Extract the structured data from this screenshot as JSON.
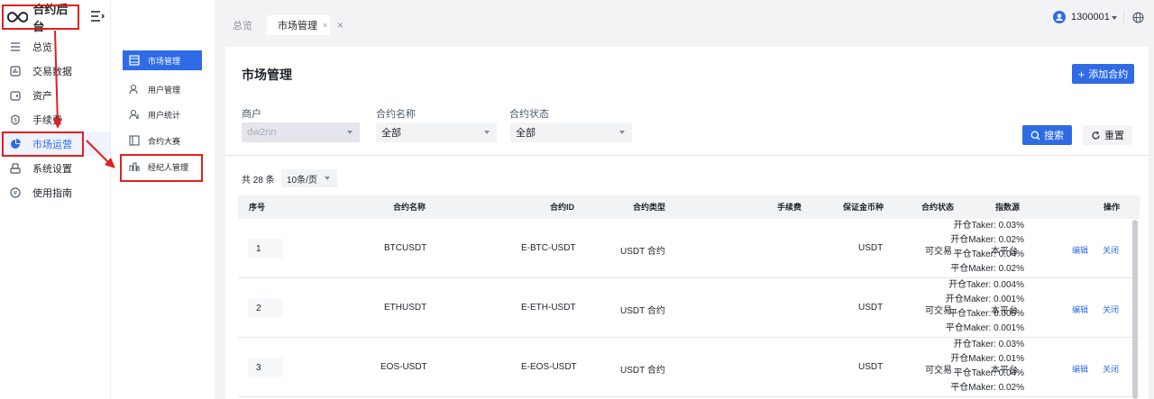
{
  "brand": {
    "name": "合约后台"
  },
  "nav": [
    {
      "label": "总览",
      "icon": "menu-icon"
    },
    {
      "label": "交易数据",
      "icon": "chart-icon"
    },
    {
      "label": "资产",
      "icon": "asset-icon"
    },
    {
      "label": "手续费",
      "icon": "fee-icon"
    },
    {
      "label": "市场运营",
      "icon": "pie-icon",
      "active": true
    },
    {
      "label": "系统设置",
      "icon": "settings-icon"
    },
    {
      "label": "使用指南",
      "icon": "guide-icon"
    }
  ],
  "subnav": [
    {
      "label": "市场管理",
      "icon": "market-icon",
      "active": true
    },
    {
      "label": "用户管理",
      "icon": "user-icon"
    },
    {
      "label": "用户统计",
      "icon": "user-stats-icon"
    },
    {
      "label": "合约大赛",
      "icon": "contest-icon"
    },
    {
      "label": "经纪人管理",
      "icon": "broker-icon"
    }
  ],
  "tabs": {
    "overview": "总览",
    "current": "市场管理"
  },
  "user": {
    "id": "1300001"
  },
  "page": {
    "title": "市场管理",
    "add_button": "添加合约"
  },
  "filters": {
    "merchant": {
      "label": "商户",
      "value": "dw2nn"
    },
    "contract_name": {
      "label": "合约名称",
      "value": "全部"
    },
    "contract_status": {
      "label": "合约状态",
      "value": "全部"
    },
    "search_button": "搜索",
    "reset_button": "重置"
  },
  "pagination": {
    "total": "共 28 条",
    "page_size": "10条/页"
  },
  "table": {
    "headers": {
      "index": "序号",
      "name": "合约名称",
      "id": "合约ID",
      "type": "合约类型",
      "fee": "手续费",
      "margin": "保证金币种",
      "status": "合约状态",
      "index_source": "指数源",
      "ops": "操作"
    },
    "rows": [
      {
        "index": "1",
        "name": "BTCUSDT",
        "id": "E-BTC-USDT",
        "type": "USDT 合约",
        "fees": [
          "开仓Taker: 0.03%",
          "开仓Maker: 0.02%",
          "平仓Taker: 0.04%",
          "平仓Maker: 0.02%"
        ],
        "margin": "USDT",
        "status": "可交易",
        "source": "本平台",
        "edit": "编辑",
        "close": "关闭"
      },
      {
        "index": "2",
        "name": "ETHUSDT",
        "id": "E-ETH-USDT",
        "type": "USDT 合约",
        "fees": [
          "开仓Taker: 0.004%",
          "开仓Maker: 0.001%",
          "平仓Taker: 0.005%",
          "平仓Maker: 0.001%"
        ],
        "margin": "USDT",
        "status": "可交易",
        "source": "本平台",
        "edit": "编辑",
        "close": "关闭"
      },
      {
        "index": "3",
        "name": "EOS-USDT",
        "id": "E-EOS-USDT",
        "type": "USDT 合约",
        "fees": [
          "开仓Taker: 0.03%",
          "开仓Maker: 0.01%",
          "平仓Taker: 0.04%",
          "平仓Maker: 0.02%"
        ],
        "margin": "USDT",
        "status": "可交易",
        "source": "本平台",
        "edit": "编辑",
        "close": "关闭"
      }
    ]
  },
  "colors": {
    "primary": "#2f6be5",
    "annotation": "#e02020"
  }
}
